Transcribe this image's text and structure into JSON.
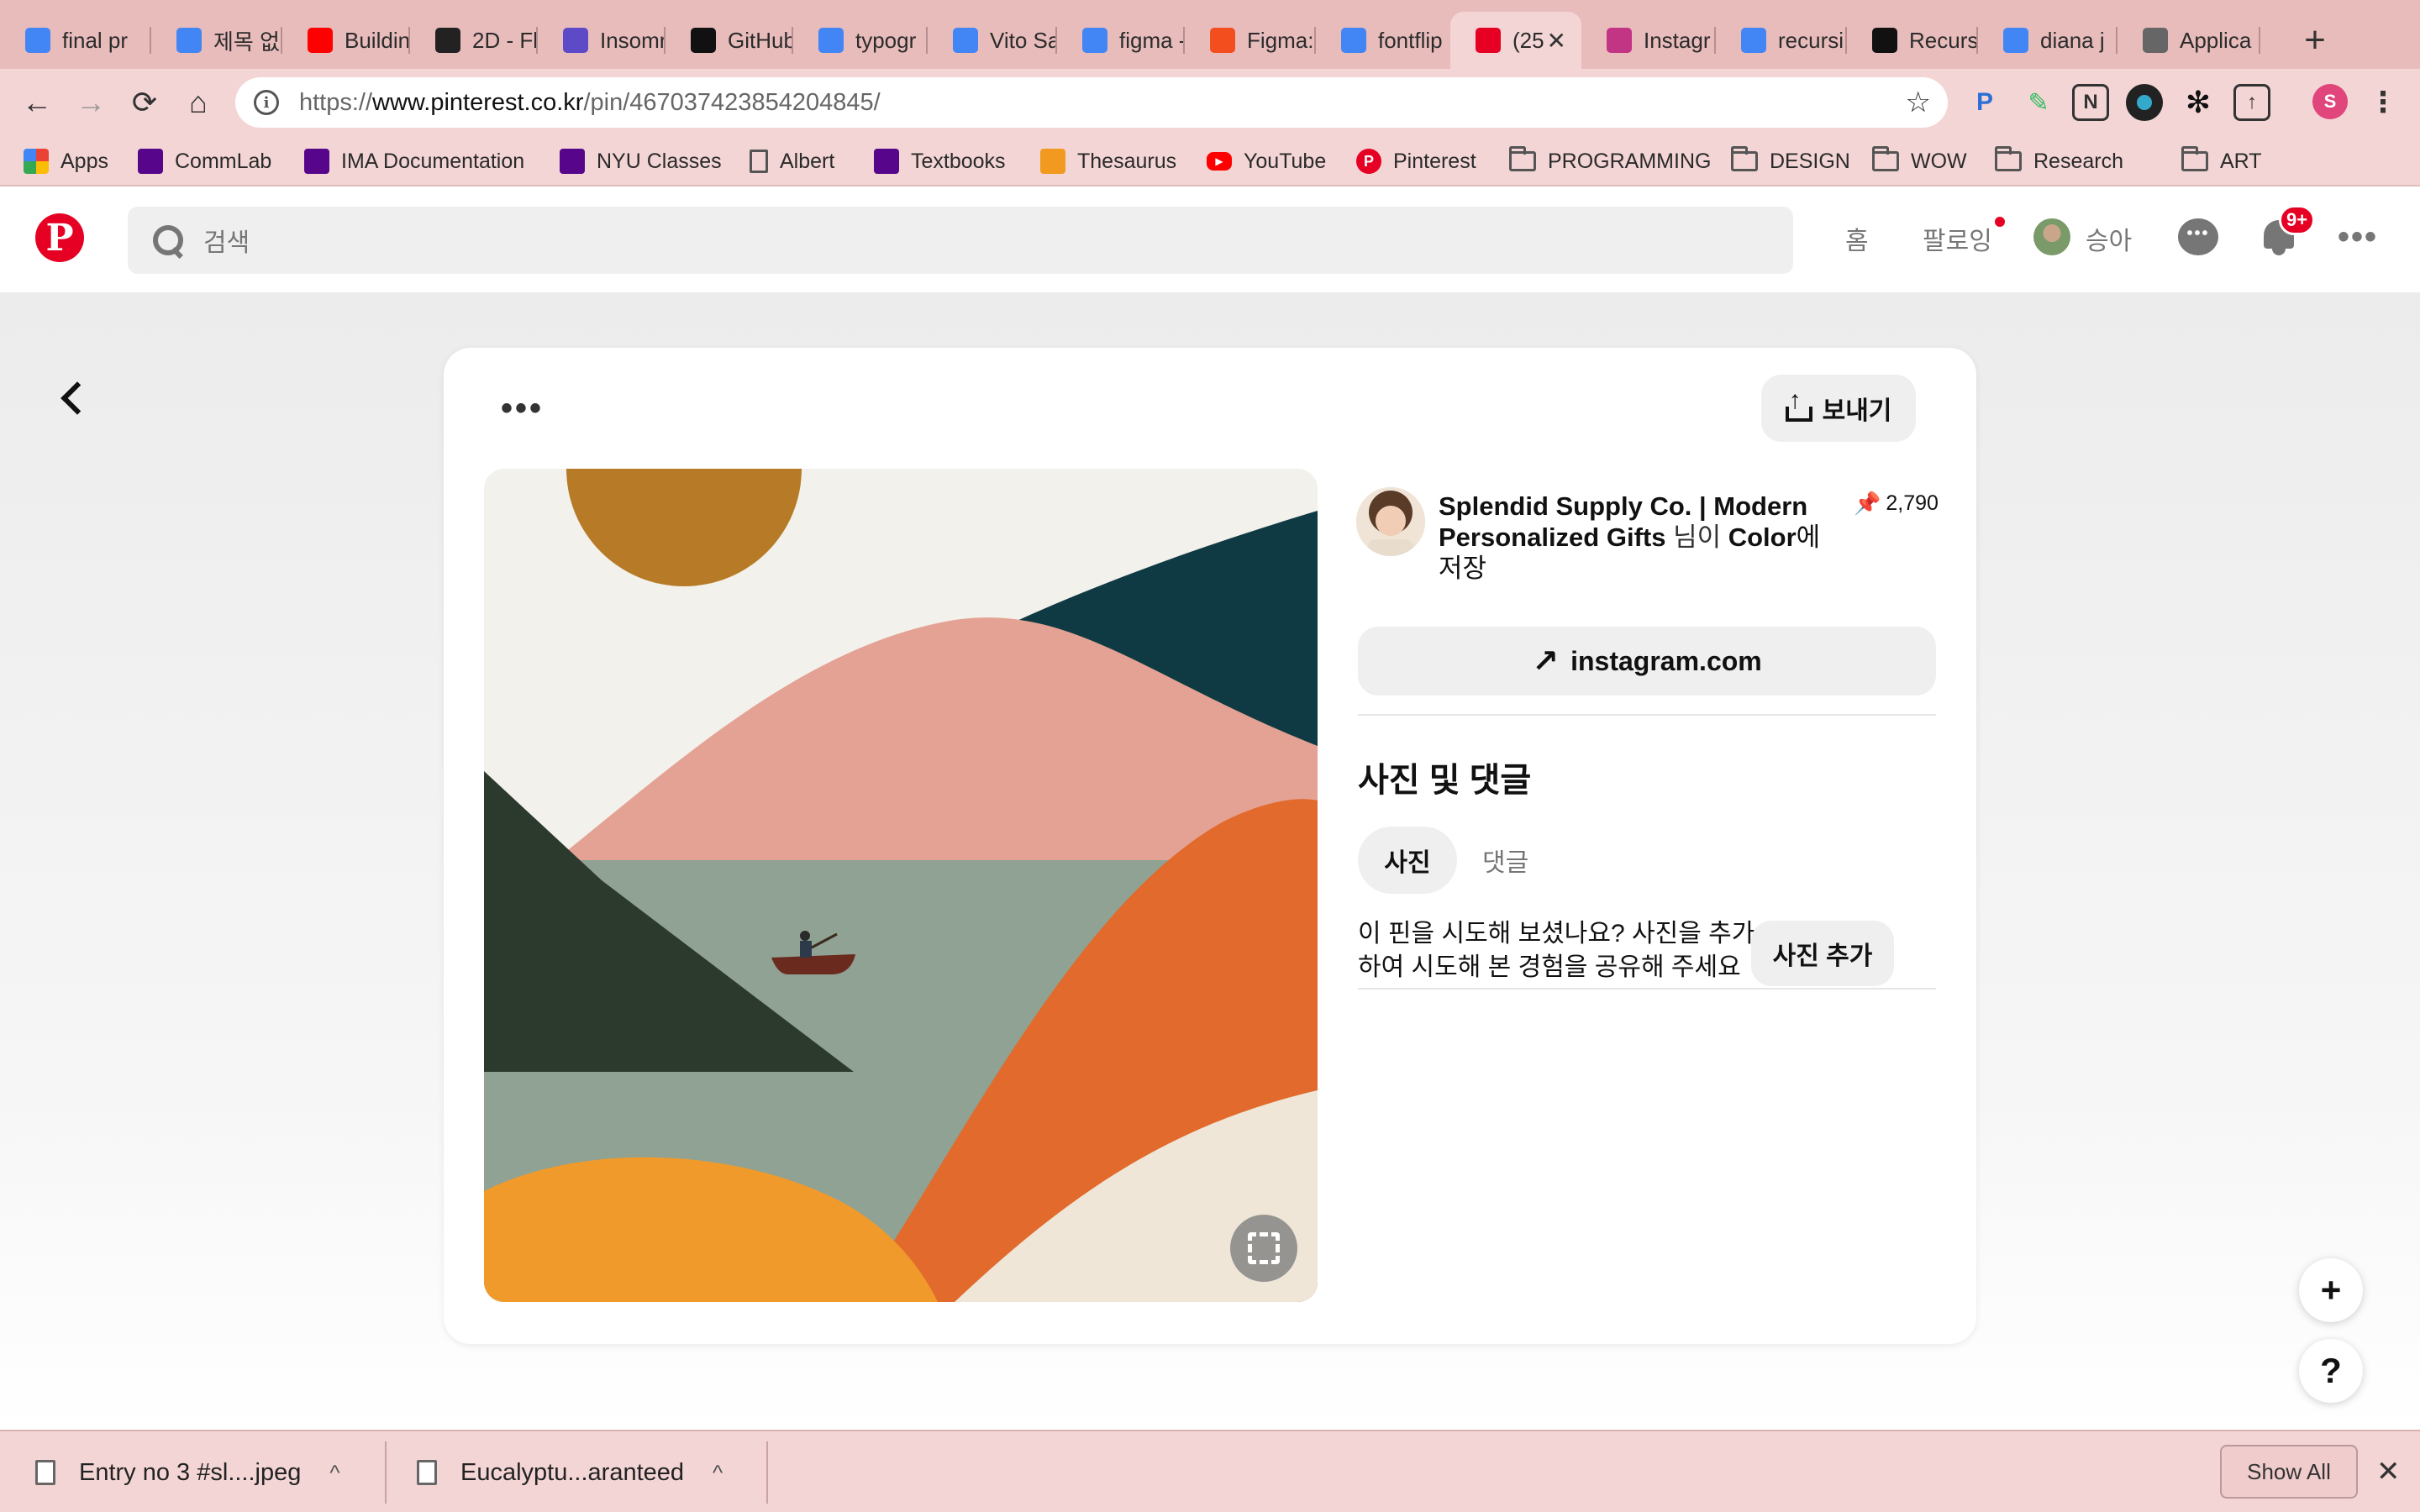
{
  "browser": {
    "tabs": [
      {
        "title": "final pr",
        "icon": "google-docs-icon",
        "color": "#4285f4"
      },
      {
        "title": "제목 없는",
        "icon": "google-docs-icon",
        "color": "#4285f4"
      },
      {
        "title": "Buildin",
        "icon": "youtube-icon",
        "color": "#ff0000"
      },
      {
        "title": "2D - Fl",
        "icon": "2d-icon",
        "color": "#222222"
      },
      {
        "title": "Insomr",
        "icon": "insomnia-icon",
        "color": "#5c4ac7"
      },
      {
        "title": "GitHub",
        "icon": "github-icon",
        "color": "#111111"
      },
      {
        "title": "typogr",
        "icon": "google-icon",
        "color": "#4285f4"
      },
      {
        "title": "Vito Sa",
        "icon": "google-icon",
        "color": "#4285f4"
      },
      {
        "title": "figma -",
        "icon": "google-icon",
        "color": "#4285f4"
      },
      {
        "title": "Figma:",
        "icon": "figma-icon",
        "color": "#f24e1e"
      },
      {
        "title": "fontflip",
        "icon": "google-icon",
        "color": "#4285f4"
      },
      {
        "title": "(25",
        "icon": "pinterest-icon",
        "color": "#e60023"
      },
      {
        "title": "Instagr",
        "icon": "instagram-icon",
        "color": "#c13584"
      },
      {
        "title": "recursi",
        "icon": "google-icon",
        "color": "#4285f4"
      },
      {
        "title": "Recurs",
        "icon": "medium-icon",
        "color": "#111111"
      },
      {
        "title": "diana j",
        "icon": "google-icon",
        "color": "#4285f4"
      },
      {
        "title": "Applica",
        "icon": "app-icon",
        "color": "#666666"
      }
    ],
    "url_prefix": "https://",
    "url_host": "www.pinterest.co.kr",
    "url_path": "/pin/467037423854204845/",
    "bookmarks": [
      {
        "label": "Apps",
        "icon": "apps-grid-icon"
      },
      {
        "label": "CommLab",
        "icon": "nyu-icon"
      },
      {
        "label": "IMA Documentation",
        "icon": "nyu-icon"
      },
      {
        "label": "NYU Classes",
        "icon": "nyu-torch-icon"
      },
      {
        "label": "Albert",
        "icon": "page-icon"
      },
      {
        "label": "Textbooks",
        "icon": "nyu-icon"
      },
      {
        "label": "Thesaurus",
        "icon": "thesaurus-icon"
      },
      {
        "label": "YouTube",
        "icon": "youtube-icon"
      },
      {
        "label": "Pinterest",
        "icon": "pinterest-icon"
      },
      {
        "label": "PROGRAMMING",
        "icon": "folder-icon"
      },
      {
        "label": "DESIGN",
        "icon": "folder-icon"
      },
      {
        "label": "WOW",
        "icon": "folder-icon"
      },
      {
        "label": "Research",
        "icon": "folder-icon"
      },
      {
        "label": "ART",
        "icon": "folder-icon"
      }
    ],
    "profile_initial": "S"
  },
  "pinterest": {
    "search_placeholder": "검색",
    "nav_home": "홈",
    "nav_following": "팔로잉",
    "username": "승아",
    "notification_badge": "9+",
    "send_label": "보내기",
    "saver_name": "Splendid Supply Co. | Modern Personalized Gifts",
    "saved_mid": " 님이 ",
    "board_name": "Color",
    "saved_suffix": "에 저장",
    "pin_count": "2,790",
    "source_link": "instagram.com",
    "photos_comments_title": "사진 및 댓글",
    "tab_photo": "사진",
    "tab_comment": "댓글",
    "try_prompt": "이 핀을 시도해 보셨나요? 사진을 추가하여 시도해 본 경험을 공유해 주세요",
    "add_photo_label": "사진 추가",
    "fab_add": "+",
    "fab_help": "?"
  },
  "downloads": {
    "items": [
      {
        "name": "Entry no 3 #sl....jpeg"
      },
      {
        "name": "Eucalyptu...aranteed"
      }
    ],
    "show_all": "Show All"
  },
  "colors": {
    "chrome_tabstrip": "#e9bcbc",
    "chrome_toolbar": "#f4d5d5",
    "pinterest_red": "#e60023"
  }
}
